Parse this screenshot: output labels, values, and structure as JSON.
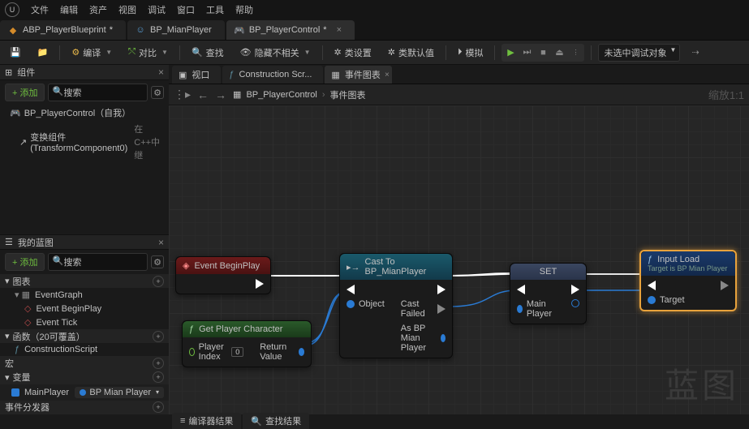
{
  "menu": {
    "file": "文件",
    "edit": "编辑",
    "asset": "资产",
    "view": "视图",
    "debug": "调试",
    "window": "窗口",
    "tools": "工具",
    "help": "帮助"
  },
  "tabs": [
    {
      "label": "ABP_PlayerBlueprint",
      "dirty": "*"
    },
    {
      "label": "BP_MianPlayer",
      "dirty": ""
    },
    {
      "label": "BP_PlayerControl",
      "dirty": "*"
    }
  ],
  "toolbar": {
    "compile": "编译",
    "diff": "对比",
    "find": "查找",
    "hide": "隐藏不相关",
    "classSettings": "类设置",
    "classDefaults": "类默认值",
    "simulate": "模拟",
    "debugSelect": "未选中调试对象"
  },
  "components": {
    "title": "组件",
    "add": "+ 添加",
    "search": "搜索",
    "root": "BP_PlayerControl（自我）",
    "child": "变换组件 (TransformComponent0)",
    "childExtra": "在C++中继"
  },
  "myBlueprint": {
    "title": "我的蓝图",
    "add": "+ 添加",
    "search": "搜索",
    "sections": {
      "graphs": "图表",
      "eventGraph": "EventGraph",
      "beginPlay": "Event BeginPlay",
      "tick": "Event Tick",
      "functions": "函数（20可覆盖）",
      "construction": "ConstructionScript",
      "macros": "宏",
      "variables": "变量",
      "var1": "MainPlayer",
      "var1type": "BP Mian Player",
      "dispatchers": "事件分发器"
    }
  },
  "centerTabs": {
    "viewport": "视口",
    "construction": "Construction Scr...",
    "eventGraph": "事件图表"
  },
  "nav": {
    "class": "BP_PlayerControl",
    "graph": "事件图表",
    "zoom": "缩放1:1"
  },
  "nodes": {
    "beginPlay": {
      "title": "Event BeginPlay"
    },
    "cast": {
      "title": "Cast To BP_MianPlayer",
      "object": "Object",
      "failed": "Cast Failed",
      "as": "As BP Mian Player"
    },
    "set": {
      "title": "SET",
      "var": "Main Player"
    },
    "inputLoad": {
      "title": "Input Load",
      "sub": "Target is BP Mian Player",
      "target": "Target"
    },
    "getPlayer": {
      "title": "Get Player Character",
      "index": "Player Index",
      "indexVal": "0",
      "return": "Return Value"
    }
  },
  "watermark": "蓝图",
  "bottom": {
    "compiler": "编译器结果",
    "find": "查找结果"
  }
}
